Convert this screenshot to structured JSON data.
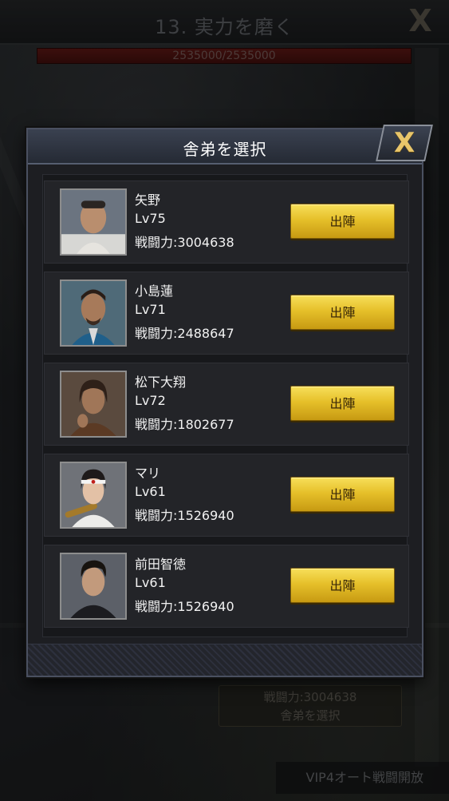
{
  "stage": {
    "title": "13. 実力を磨く",
    "hp_text": "2535000/2535000",
    "hp_fraction": 1.0,
    "close_icon": "x-icon"
  },
  "modal": {
    "title": "舎弟を選択",
    "close_icon": "x-icon",
    "items": [
      {
        "name": "矢野",
        "level": "Lv75",
        "power": "戦闘力:3004638",
        "button": "出陣",
        "portrait": "bald-man-white-suit"
      },
      {
        "name": "小島蓮",
        "level": "Lv71",
        "power": "戦闘力:2488647",
        "button": "出陣",
        "portrait": "bearded-man-blue-suit"
      },
      {
        "name": "松下大翔",
        "level": "Lv72",
        "power": "戦闘力:1802677",
        "button": "出陣",
        "portrait": "long-hair-man-leather-jacket"
      },
      {
        "name": "マリ",
        "level": "Lv61",
        "power": "戦闘力:1526940",
        "button": "出陣",
        "portrait": "woman-headband-bat"
      },
      {
        "name": "前田智徳",
        "level": "Lv61",
        "power": "戦闘力:1526940",
        "button": "出陣",
        "portrait": "man-black-jacket"
      }
    ]
  },
  "bottom": {
    "power": "戦闘力:3004638",
    "select_label": "舎弟を選択",
    "vip_label": "VIP4オート戦闘開放"
  },
  "colors": {
    "accent_gold": "#e6c02a",
    "hp_red": "#6d1c18",
    "panel": "#232428"
  }
}
